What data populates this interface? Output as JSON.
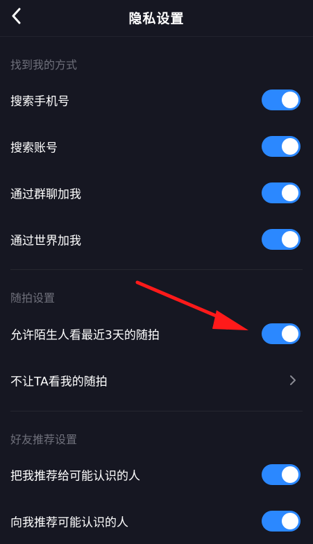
{
  "header": {
    "title": "隐私设置",
    "back_icon": "chevron-left-icon"
  },
  "sections": [
    {
      "label": "找到我的方式",
      "rows": [
        {
          "label": "搜索手机号",
          "control": "toggle",
          "on": true
        },
        {
          "label": "搜索账号",
          "control": "toggle",
          "on": true
        },
        {
          "label": "通过群聊加我",
          "control": "toggle",
          "on": true
        },
        {
          "label": "通过世界加我",
          "control": "toggle",
          "on": true
        }
      ]
    },
    {
      "label": "随拍设置",
      "rows": [
        {
          "label": "允许陌生人看最近3天的随拍",
          "control": "toggle",
          "on": true
        },
        {
          "label": "不让TA看我的随拍",
          "control": "chevron"
        }
      ]
    },
    {
      "label": "好友推荐设置",
      "rows": [
        {
          "label": "把我推荐给可能认识的人",
          "control": "toggle",
          "on": true
        },
        {
          "label": "向我推荐可能认识的人",
          "control": "toggle",
          "on": true
        }
      ]
    }
  ],
  "colors": {
    "background": "#161722",
    "toggle_on": "#2b88ff",
    "annotation_arrow": "#ff1a1a"
  },
  "annotation": {
    "icon": "red-arrow-annotation"
  }
}
